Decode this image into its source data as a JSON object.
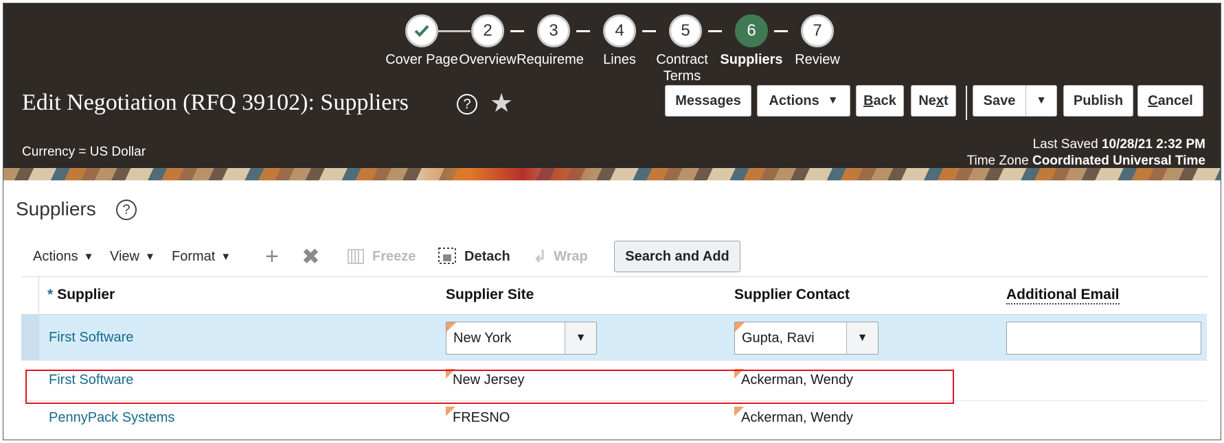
{
  "train": {
    "stops": [
      {
        "number": "",
        "label": "Cover Page",
        "state": "complete"
      },
      {
        "number": "2",
        "label": "Overview",
        "state": "pending"
      },
      {
        "number": "3",
        "label": "Requireme",
        "state": "pending"
      },
      {
        "number": "4",
        "label": "Lines",
        "state": "pending"
      },
      {
        "number": "5",
        "label": "Contract Terms",
        "state": "pending"
      },
      {
        "number": "6",
        "label": "Suppliers",
        "state": "current"
      },
      {
        "number": "7",
        "label": "Review",
        "state": "pending"
      }
    ]
  },
  "header": {
    "title": "Edit Negotiation (RFQ 39102): Suppliers",
    "help_glyph": "?",
    "star_glyph": "★",
    "buttons": {
      "messages": "Messages",
      "actions": "Actions",
      "back_u": "B",
      "back_rest": "ack",
      "next_pre": "Ne",
      "next_u": "x",
      "next_rest": "t",
      "save": "Save",
      "publish": "Publish",
      "cancel_u": "C",
      "cancel_rest": "ancel"
    },
    "currency": "Currency = US Dollar",
    "last_saved_label": "Last Saved",
    "last_saved_value": "10/28/21 2:32 PM",
    "time_zone_label": "Time Zone",
    "time_zone_value": "Coordinated Universal Time"
  },
  "section": {
    "title": "Suppliers",
    "help_glyph": "?"
  },
  "toolbar": {
    "actions": "Actions",
    "view": "View",
    "format": "Format",
    "freeze": "Freeze",
    "detach": "Detach",
    "wrap": "Wrap",
    "search_and_add": "Search and Add",
    "caret": "▼"
  },
  "table": {
    "required_marker": "*",
    "columns": [
      "Supplier",
      "Supplier Site",
      "Supplier Contact",
      "Additional Email"
    ],
    "rows": [
      {
        "supplier": "First Software",
        "site": "New York",
        "contact": "Gupta, Ravi",
        "email": "",
        "selected": true
      },
      {
        "supplier": "First Software",
        "site": "New Jersey",
        "contact": "Ackerman, Wendy",
        "email": "",
        "highlighted": true
      },
      {
        "supplier": "PennyPack Systems",
        "site": "FRESNO",
        "contact": "Ackerman, Wendy",
        "email": ""
      }
    ]
  },
  "colors": {
    "header_bg": "#302a26",
    "current_step": "#3f7a54",
    "link": "#166a8c",
    "selected_row": "#d6ebf8",
    "highlight_border": "#e0141e"
  }
}
